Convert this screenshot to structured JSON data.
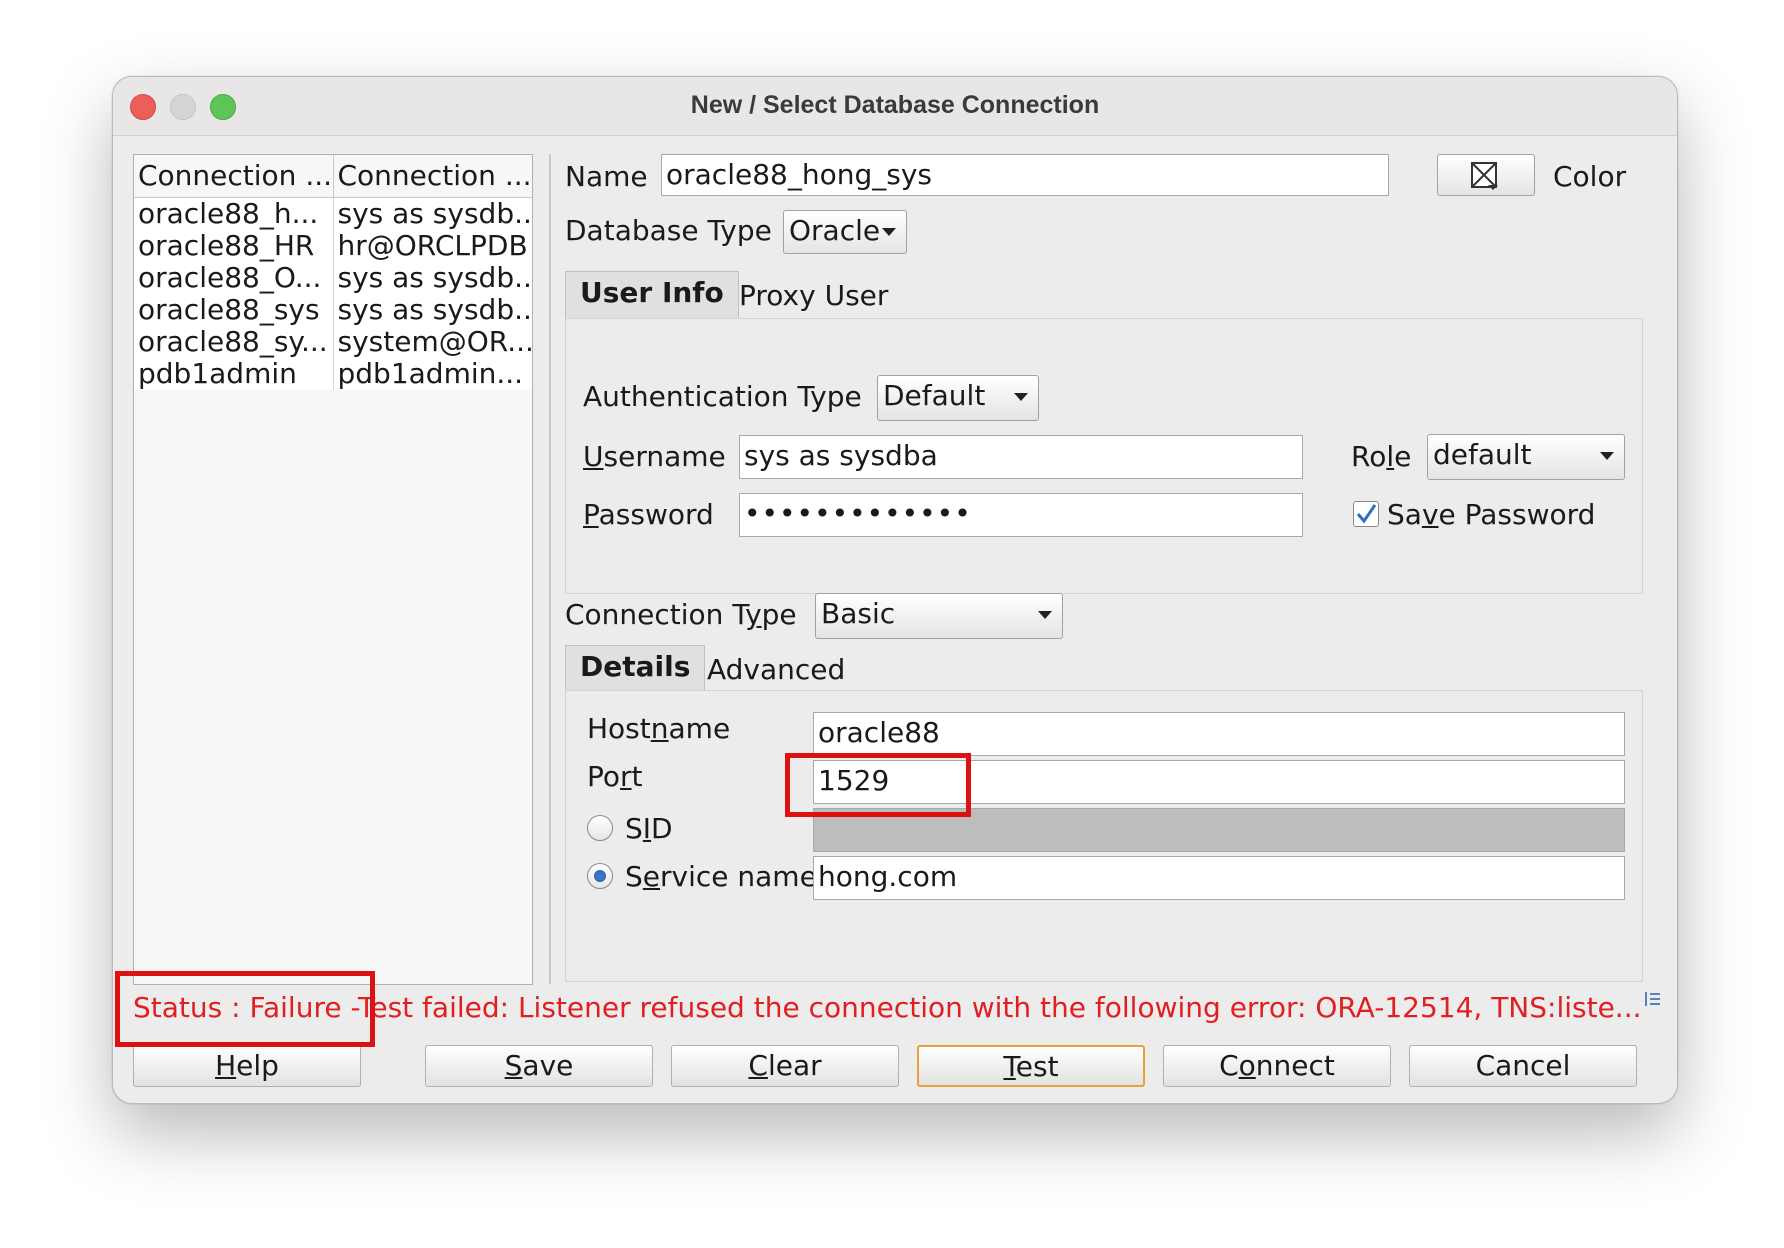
{
  "window": {
    "title": "New / Select Database Connection"
  },
  "connections": {
    "headers": [
      "Connection ...",
      "Connection ..."
    ],
    "rows": [
      [
        "oracle88_h...",
        "sys as sysdb..."
      ],
      [
        "oracle88_HR",
        "hr@ORCLPDB"
      ],
      [
        "oracle88_O...",
        "sys as sysdb..."
      ],
      [
        "oracle88_sys",
        "sys as sysdb..."
      ],
      [
        "oracle88_sy...",
        "system@OR..."
      ],
      [
        "pdb1admin",
        "pdb1admin..."
      ]
    ]
  },
  "form": {
    "name_label": "Name",
    "name_value": "oracle88_hong_sys",
    "color_label": "Color",
    "dbtype_label": "Database Type",
    "dbtype_value": "Oracle",
    "tabs": [
      "User Info",
      "Proxy User"
    ],
    "auth_label": "Authentication Type",
    "auth_value": "Default",
    "username_label": "Username",
    "username_value": "sys as sysdba",
    "role_label": "Role",
    "role_value": "default",
    "password_label": "Password",
    "password_value": "•••••••••••••",
    "save_password_label": "Save Password",
    "save_password_checked": true,
    "conn_type_label": "Connection Type",
    "conn_type_value": "Basic",
    "detail_tabs": [
      "Details",
      "Advanced"
    ],
    "hostname_label": "Hostname",
    "hostname_value": "oracle88",
    "port_label": "Port",
    "port_value": "1529",
    "sid_label": "SID",
    "sid_value": "",
    "service_label": "Service name",
    "service_value": "hong.com",
    "selected_connect_by": "Service name"
  },
  "status": {
    "text": "Status : Failure -Test failed: Listener refused the connection with the following error: ORA-12514, TNS:liste...",
    "color": "#e02020"
  },
  "buttons": {
    "help": "Help",
    "save": "Save",
    "clear": "Clear",
    "test": "Test",
    "connect": "Connect",
    "cancel": "Cancel"
  },
  "colors": {
    "highlight": "#dd1111",
    "default_button_border": "#e9a23b"
  }
}
